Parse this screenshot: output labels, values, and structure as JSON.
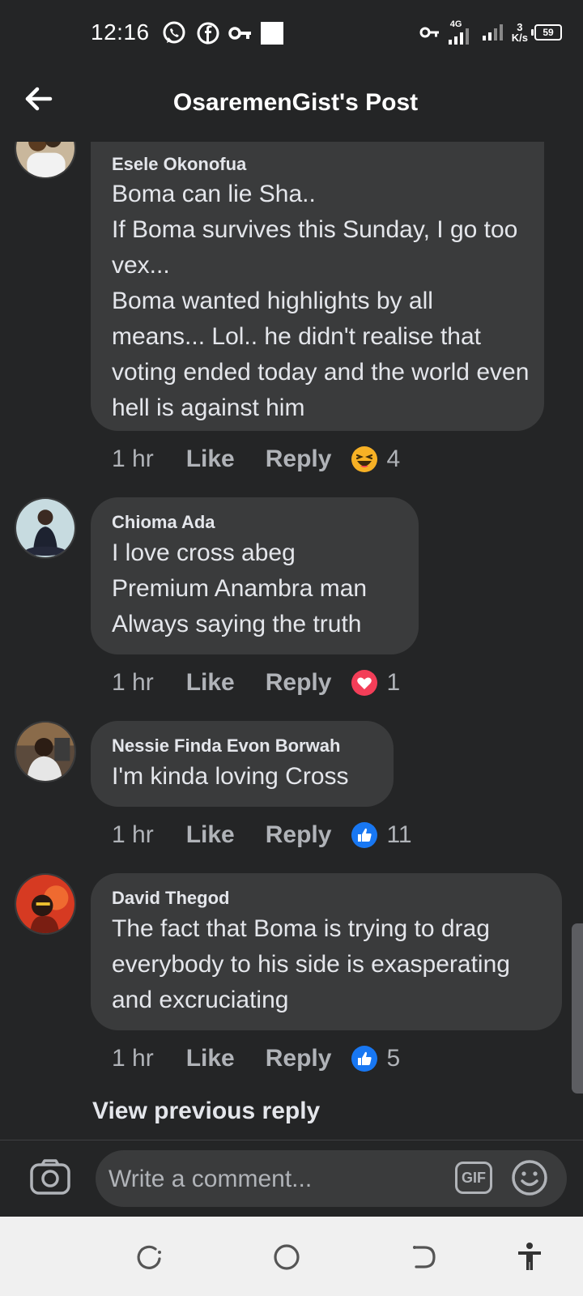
{
  "status_bar": {
    "time": "12:16",
    "network_label": "4G",
    "speed_value": "3",
    "speed_unit": "K/s",
    "battery": "59"
  },
  "header": {
    "title": "OsaremenGist's Post"
  },
  "comments": [
    {
      "author": "Esele Okonofua",
      "text": "Boma can lie Sha..\nIf Boma survives this Sunday, I go too vex...\nBoma wanted highlights by all means...  Lol.. he didn't realise that voting ended today and the world even hell is against him",
      "time": "1 hr",
      "like_label": "Like",
      "reply_label": "Reply",
      "reaction": "haha-icon",
      "reaction_count": "4"
    },
    {
      "author": "Chioma Ada",
      "text": "I love cross abeg\nPremium Anambra man\nAlways saying the truth",
      "time": "1 hr",
      "like_label": "Like",
      "reply_label": "Reply",
      "reaction": "love-icon",
      "reaction_count": "1"
    },
    {
      "author": "Nessie Finda Evon Borwah",
      "text": "I'm kinda loving Cross",
      "time": "1 hr",
      "like_label": "Like",
      "reply_label": "Reply",
      "reaction": "like-icon",
      "reaction_count": "11"
    },
    {
      "author": "David Thegod",
      "text": "The fact that Boma is trying to drag everybody to his side is exasperating and excruciating",
      "time": "1 hr",
      "like_label": "Like",
      "reply_label": "Reply",
      "reaction": "like-icon",
      "reaction_count": "5"
    }
  ],
  "view_previous": "View previous reply",
  "composer": {
    "placeholder": "Write a comment...",
    "gif_label": "GIF"
  },
  "colors": {
    "background": "#242526",
    "bubble": "#3a3b3c",
    "text": "#e4e6eb",
    "secondary_text": "#b0b3b8",
    "like_blue": "#1877f2",
    "love_red": "#f33e58",
    "haha_yellow": "#f7b125"
  }
}
